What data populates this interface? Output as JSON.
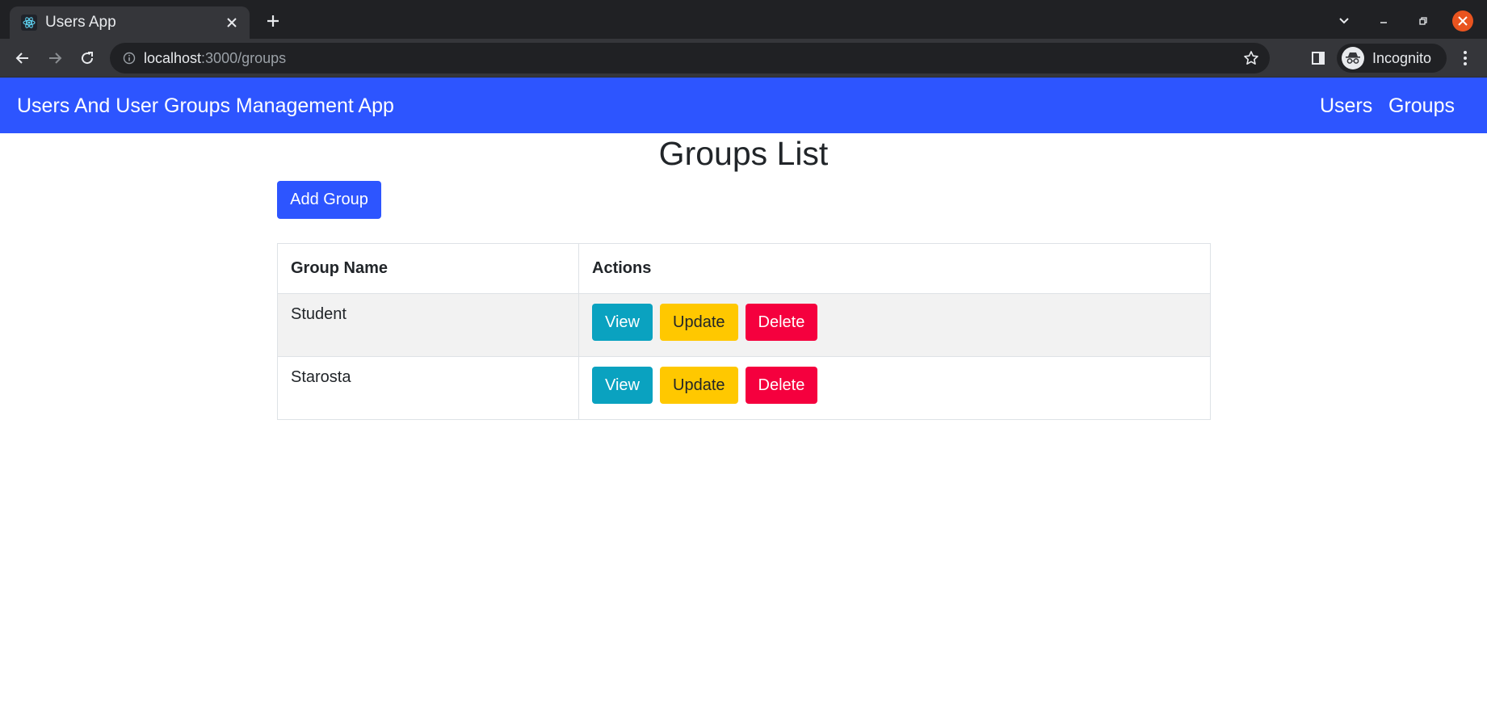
{
  "browser": {
    "tab_title": "Users App",
    "url_host": "localhost",
    "url_path": ":3000/groups",
    "profile_label": "Incognito",
    "icons": {
      "favicon": "react-icon",
      "tab_close": "close-icon",
      "new_tab": "plus-icon",
      "back": "arrow-left-icon",
      "forward": "arrow-right-icon",
      "reload": "reload-icon",
      "site_info": "info-icon",
      "bookmark": "star-icon",
      "side_panel": "side-panel-icon",
      "incognito": "incognito-icon",
      "menu": "kebab-menu-icon"
    }
  },
  "navbar": {
    "brand": "Users And User Groups Management App",
    "links": [
      {
        "label": "Users"
      },
      {
        "label": "Groups"
      }
    ],
    "color": "#2d55ff"
  },
  "main": {
    "title": "Groups List",
    "add_button": "Add Group",
    "table": {
      "headers": [
        "Group Name",
        "Actions"
      ],
      "rows": [
        {
          "name": "Student",
          "actions": [
            "View",
            "Update",
            "Delete"
          ]
        },
        {
          "name": "Starosta",
          "actions": [
            "View",
            "Update",
            "Delete"
          ]
        }
      ]
    },
    "colors": {
      "view": "#0aa2c0",
      "update": "#ffc800",
      "delete": "#f5003e"
    }
  }
}
